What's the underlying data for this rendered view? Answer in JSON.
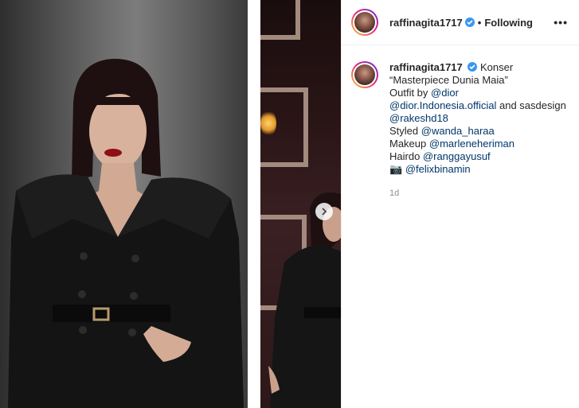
{
  "post": {
    "username": "raffinagita1717",
    "follow_status": "Following",
    "separator": "•",
    "more_icon": "more-horizontal-icon",
    "caption_lines": [
      [
        {
          "t": "text",
          "v": " Konser"
        }
      ],
      [
        {
          "t": "text",
          "v": "“Masterpiece Dunia Maia”"
        }
      ],
      [
        {
          "t": "text",
          "v": "Outfit by "
        },
        {
          "t": "mention",
          "v": "@dior"
        }
      ],
      [
        {
          "t": "mention",
          "v": "@dior.Indonesia.official"
        },
        {
          "t": "text",
          "v": " and sasdesign"
        }
      ],
      [
        {
          "t": "mention",
          "v": "@rakeshd18"
        }
      ],
      [
        {
          "t": "text",
          "v": "Styled "
        },
        {
          "t": "mention",
          "v": "@wanda_haraa"
        }
      ],
      [
        {
          "t": "text",
          "v": "Makeup "
        },
        {
          "t": "mention",
          "v": "@marleneheriman"
        }
      ],
      [
        {
          "t": "text",
          "v": "Hairdo "
        },
        {
          "t": "mention",
          "v": "@ranggayusuf"
        }
      ],
      [
        {
          "t": "text",
          "v": "📷 "
        },
        {
          "t": "mention",
          "v": "@felixbinamin"
        }
      ]
    ],
    "timestamp": "1d"
  },
  "colors": {
    "mention": "#00376b",
    "verified": "#3897f0",
    "timestamp": "#8e8e8e"
  }
}
